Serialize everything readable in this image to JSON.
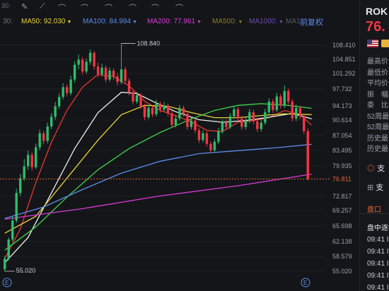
{
  "toolbar": {
    "partial_label": "30:",
    "icons": [
      "pen-icon",
      "line-tool-icon",
      "arch-icon",
      "arch-icon",
      "arch-icon",
      "arch-icon",
      "arch-icon",
      "arch-icon"
    ]
  },
  "ma": [
    {
      "label": "MA50:",
      "value": "92.030",
      "color": "#e8d23c"
    },
    {
      "label": "MA100:",
      "value": "84.994",
      "color": "#5b8def"
    },
    {
      "label": "MA200:",
      "value": "77.961",
      "color": "#d63bd6"
    },
    {
      "label": "MA500:",
      "value": "",
      "color": "#8b7e22"
    },
    {
      "label": "MA1000:",
      "value": "",
      "color": "#6a4db6"
    },
    {
      "label": "MA1",
      "value": "",
      "color": "#555a63"
    }
  ],
  "adjust_label": "前复权",
  "annotations": {
    "high": "108.840",
    "low": "55.020"
  },
  "current_price_label": "76.811",
  "chart_data": {
    "type": "candlestick",
    "y_ticks": [
      "108.410",
      "104.851",
      "101.292",
      "97.732",
      "94.173",
      "90.614",
      "87.054",
      "83.495",
      "79.935",
      "72.817",
      "69.257",
      "65.698",
      "62.138",
      "58.579",
      "55.020"
    ],
    "ylim": [
      55.02,
      108.84
    ],
    "period_high": 108.84,
    "period_low": 55.02,
    "last_price": 76.811,
    "candles": [
      {
        "o": 55.5,
        "c": 58.0,
        "h": 58.6,
        "l": 55.02
      },
      {
        "o": 58.0,
        "c": 62.5,
        "h": 63.0,
        "l": 57.6
      },
      {
        "o": 62.5,
        "c": 67.0,
        "h": 68.0,
        "l": 62.0
      },
      {
        "o": 67.0,
        "c": 73.5,
        "h": 74.5,
        "l": 66.5
      },
      {
        "o": 73.5,
        "c": 77.0,
        "h": 78.0,
        "l": 72.8
      },
      {
        "o": 77.0,
        "c": 79.8,
        "h": 81.5,
        "l": 76.3
      },
      {
        "o": 79.8,
        "c": 82.5,
        "h": 83.5,
        "l": 79.0
      },
      {
        "o": 82.5,
        "c": 79.6,
        "h": 83.2,
        "l": 78.8
      },
      {
        "o": 79.6,
        "c": 84.3,
        "h": 85.2,
        "l": 79.2
      },
      {
        "o": 84.3,
        "c": 87.6,
        "h": 88.5,
        "l": 83.6
      },
      {
        "o": 87.6,
        "c": 85.8,
        "h": 88.2,
        "l": 85.0
      },
      {
        "o": 85.8,
        "c": 89.2,
        "h": 90.1,
        "l": 85.2
      },
      {
        "o": 89.2,
        "c": 91.5,
        "h": 92.4,
        "l": 88.6
      },
      {
        "o": 91.5,
        "c": 94.0,
        "h": 95.0,
        "l": 90.8
      },
      {
        "o": 94.0,
        "c": 96.2,
        "h": 97.0,
        "l": 93.3
      },
      {
        "o": 96.2,
        "c": 98.5,
        "h": 99.4,
        "l": 95.6
      },
      {
        "o": 98.5,
        "c": 97.1,
        "h": 99.2,
        "l": 96.3
      },
      {
        "o": 97.1,
        "c": 100.3,
        "h": 101.2,
        "l": 96.6
      },
      {
        "o": 100.3,
        "c": 103.8,
        "h": 104.6,
        "l": 99.6
      },
      {
        "o": 103.8,
        "c": 105.0,
        "h": 106.2,
        "l": 102.7
      },
      {
        "o": 105.0,
        "c": 102.2,
        "h": 105.6,
        "l": 101.5
      },
      {
        "o": 102.2,
        "c": 104.5,
        "h": 105.3,
        "l": 101.7
      },
      {
        "o": 104.5,
        "c": 106.6,
        "h": 107.4,
        "l": 103.8
      },
      {
        "o": 106.6,
        "c": 103.4,
        "h": 107.0,
        "l": 102.6
      },
      {
        "o": 103.4,
        "c": 101.6,
        "h": 104.3,
        "l": 100.8
      },
      {
        "o": 101.6,
        "c": 103.1,
        "h": 104.0,
        "l": 101.0
      },
      {
        "o": 103.1,
        "c": 100.3,
        "h": 103.6,
        "l": 99.6
      },
      {
        "o": 100.3,
        "c": 102.4,
        "h": 103.2,
        "l": 99.8
      },
      {
        "o": 102.4,
        "c": 101.0,
        "h": 103.0,
        "l": 100.2
      },
      {
        "o": 101.0,
        "c": 99.7,
        "h": 101.8,
        "l": 98.9
      },
      {
        "o": 99.7,
        "c": 102.7,
        "h": 108.84,
        "l": 99.2
      },
      {
        "o": 102.7,
        "c": 100.0,
        "h": 103.3,
        "l": 99.3
      },
      {
        "o": 100.0,
        "c": 97.3,
        "h": 100.6,
        "l": 96.5
      },
      {
        "o": 97.3,
        "c": 95.1,
        "h": 97.9,
        "l": 94.4
      },
      {
        "o": 95.1,
        "c": 96.6,
        "h": 97.4,
        "l": 94.6
      },
      {
        "o": 96.6,
        "c": 94.0,
        "h": 97.1,
        "l": 93.3
      },
      {
        "o": 94.0,
        "c": 91.4,
        "h": 94.6,
        "l": 90.7
      },
      {
        "o": 91.4,
        "c": 93.6,
        "h": 94.4,
        "l": 90.9
      },
      {
        "o": 93.6,
        "c": 92.1,
        "h": 94.1,
        "l": 91.4
      },
      {
        "o": 92.1,
        "c": 94.6,
        "h": 95.5,
        "l": 91.6
      },
      {
        "o": 94.6,
        "c": 93.2,
        "h": 95.1,
        "l": 92.5
      },
      {
        "o": 93.2,
        "c": 94.1,
        "h": 95.0,
        "l": 92.6
      },
      {
        "o": 94.1,
        "c": 92.3,
        "h": 94.6,
        "l": 91.6
      },
      {
        "o": 92.3,
        "c": 89.6,
        "h": 92.9,
        "l": 88.9
      },
      {
        "o": 89.6,
        "c": 91.1,
        "h": 91.9,
        "l": 89.0
      },
      {
        "o": 91.1,
        "c": 93.6,
        "h": 94.3,
        "l": 90.6
      },
      {
        "o": 93.6,
        "c": 92.2,
        "h": 94.1,
        "l": 91.5
      },
      {
        "o": 92.2,
        "c": 89.1,
        "h": 92.8,
        "l": 88.4
      },
      {
        "o": 89.1,
        "c": 90.6,
        "h": 91.3,
        "l": 88.5
      },
      {
        "o": 90.6,
        "c": 88.3,
        "h": 91.1,
        "l": 87.6
      },
      {
        "o": 88.3,
        "c": 86.0,
        "h": 88.9,
        "l": 85.3
      },
      {
        "o": 86.0,
        "c": 87.6,
        "h": 88.3,
        "l": 85.4
      },
      {
        "o": 87.6,
        "c": 85.1,
        "h": 88.1,
        "l": 84.4
      },
      {
        "o": 85.1,
        "c": 83.6,
        "h": 85.7,
        "l": 82.9
      },
      {
        "o": 83.6,
        "c": 85.6,
        "h": 86.3,
        "l": 83.1
      },
      {
        "o": 85.6,
        "c": 88.1,
        "h": 88.9,
        "l": 85.1
      },
      {
        "o": 88.1,
        "c": 90.1,
        "h": 90.9,
        "l": 87.5
      },
      {
        "o": 90.1,
        "c": 89.1,
        "h": 90.9,
        "l": 88.4
      },
      {
        "o": 89.1,
        "c": 91.6,
        "h": 92.4,
        "l": 88.6
      },
      {
        "o": 91.6,
        "c": 93.3,
        "h": 94.1,
        "l": 91.0
      },
      {
        "o": 93.3,
        "c": 91.1,
        "h": 93.9,
        "l": 90.4
      },
      {
        "o": 91.1,
        "c": 89.1,
        "h": 91.7,
        "l": 88.4
      },
      {
        "o": 89.1,
        "c": 90.6,
        "h": 91.4,
        "l": 88.5
      },
      {
        "o": 90.6,
        "c": 92.6,
        "h": 93.4,
        "l": 90.0
      },
      {
        "o": 92.6,
        "c": 90.4,
        "h": 93.2,
        "l": 89.7
      },
      {
        "o": 90.4,
        "c": 88.6,
        "h": 91.0,
        "l": 87.9
      },
      {
        "o": 88.6,
        "c": 90.1,
        "h": 90.9,
        "l": 88.0
      },
      {
        "o": 90.1,
        "c": 92.6,
        "h": 93.4,
        "l": 89.6
      },
      {
        "o": 92.6,
        "c": 95.1,
        "h": 95.9,
        "l": 92.0
      },
      {
        "o": 95.1,
        "c": 93.1,
        "h": 95.7,
        "l": 92.4
      },
      {
        "o": 93.1,
        "c": 96.3,
        "h": 97.1,
        "l": 92.6
      },
      {
        "o": 96.3,
        "c": 94.1,
        "h": 96.9,
        "l": 93.4
      },
      {
        "o": 94.1,
        "c": 97.6,
        "h": 98.9,
        "l": 93.6
      },
      {
        "o": 97.6,
        "c": 95.1,
        "h": 98.2,
        "l": 94.4
      },
      {
        "o": 95.1,
        "c": 91.1,
        "h": 95.7,
        "l": 90.4
      },
      {
        "o": 91.1,
        "c": 93.6,
        "h": 94.4,
        "l": 90.5
      },
      {
        "o": 93.6,
        "c": 91.6,
        "h": 94.1,
        "l": 90.9
      },
      {
        "o": 91.6,
        "c": 88.1,
        "h": 92.1,
        "l": 87.4
      },
      {
        "o": 88.1,
        "c": 76.811,
        "h": 88.8,
        "l": 76.4
      }
    ],
    "ma_lines": [
      {
        "color": "#e8382f",
        "values": [
          [
            0,
            58.0
          ],
          [
            4,
            65.0
          ],
          [
            8,
            76.0
          ],
          [
            12,
            85.5
          ],
          [
            16,
            93.0
          ],
          [
            20,
            98.5
          ],
          [
            24,
            101.5
          ],
          [
            28,
            101.0
          ],
          [
            32,
            98.8
          ],
          [
            36,
            95.2
          ],
          [
            40,
            93.0
          ],
          [
            44,
            91.8
          ],
          [
            48,
            90.3
          ],
          [
            52,
            88.3
          ],
          [
            56,
            88.0
          ],
          [
            60,
            90.2
          ],
          [
            64,
            90.6
          ],
          [
            68,
            91.3
          ],
          [
            72,
            93.0
          ],
          [
            76,
            92.0
          ],
          [
            79,
            89.5
          ]
        ]
      },
      {
        "color": "#f0eeee",
        "values": [
          [
            0,
            57.0
          ],
          [
            6,
            63.0
          ],
          [
            12,
            73.5
          ],
          [
            18,
            84.0
          ],
          [
            24,
            92.5
          ],
          [
            30,
            97.3
          ],
          [
            34,
            97.0
          ],
          [
            38,
            95.2
          ],
          [
            44,
            92.7
          ],
          [
            50,
            90.8
          ],
          [
            56,
            90.2
          ],
          [
            62,
            90.6
          ],
          [
            68,
            91.4
          ],
          [
            74,
            92.3
          ],
          [
            79,
            91.0
          ]
        ]
      },
      {
        "color": "#e8d23c",
        "values": [
          [
            0,
            64.0
          ],
          [
            8,
            68.0
          ],
          [
            16,
            77.0
          ],
          [
            24,
            86.0
          ],
          [
            30,
            92.0
          ],
          [
            36,
            94.2
          ],
          [
            42,
            94.0
          ],
          [
            48,
            92.5
          ],
          [
            54,
            91.3
          ],
          [
            60,
            91.3
          ],
          [
            66,
            91.8
          ],
          [
            72,
            92.2
          ],
          [
            79,
            92.03
          ]
        ]
      },
      {
        "color": "#3fd14a",
        "values": [
          [
            0,
            60.0
          ],
          [
            8,
            65.5
          ],
          [
            16,
            72.5
          ],
          [
            24,
            79.0
          ],
          [
            32,
            84.0
          ],
          [
            40,
            87.8
          ],
          [
            48,
            91.0
          ],
          [
            54,
            93.0
          ],
          [
            60,
            94.2
          ],
          [
            66,
            94.6
          ],
          [
            72,
            94.3
          ],
          [
            79,
            93.5
          ]
        ]
      },
      {
        "color": "#5b8def",
        "values": [
          [
            0,
            67.5
          ],
          [
            10,
            70.2
          ],
          [
            20,
            74.3
          ],
          [
            30,
            78.2
          ],
          [
            40,
            81.0
          ],
          [
            50,
            82.8
          ],
          [
            60,
            83.5
          ],
          [
            70,
            84.2
          ],
          [
            79,
            84.994
          ]
        ]
      },
      {
        "color": "#d63bd6",
        "values": [
          [
            0,
            67.3
          ],
          [
            20,
            69.8
          ],
          [
            40,
            72.8
          ],
          [
            60,
            75.2
          ],
          [
            79,
            77.961
          ]
        ]
      }
    ]
  },
  "right_panel": {
    "ticker": "ROK",
    "price": "76.",
    "stats": [
      "最高价",
      "最低价",
      "平均价",
      "振　幅",
      "委　比",
      "52周最",
      "52周最",
      "历史最",
      "历史最"
    ],
    "buttons": [
      "支",
      "支"
    ],
    "tab": "盘口",
    "section": "盘中逐笔",
    "times": [
      "09:41 I",
      "09:41 I",
      "09:41 I",
      "09:41 I",
      "09:41 I"
    ]
  }
}
